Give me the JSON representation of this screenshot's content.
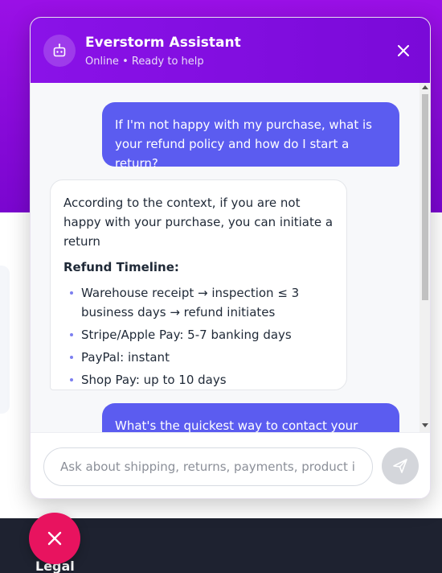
{
  "header": {
    "title": "Everstorm Assistant",
    "status": "Online • Ready to help",
    "avatar_icon": "robot-icon",
    "close_icon": "close-icon"
  },
  "messages": {
    "user_1": "If I'm not happy with my purchase, what is your refund policy and how do I start a return?",
    "bot_1": {
      "intro": "According to the context, if you are not happy with your purchase, you can initiate a return",
      "heading": "Refund Timeline:",
      "items": [
        "Warehouse receipt → inspection ≤ 3 business days → refund initiates",
        "Stripe/Apple Pay: 5-7 banking days",
        "PayPal: instant",
        "Shop Pay: up to 10 days"
      ]
    },
    "user_2": "What's the quickest way to contact your"
  },
  "input": {
    "placeholder": "Ask about shipping, returns, payments, product info...",
    "send_icon": "send-icon"
  },
  "fab": {
    "icon": "close-icon"
  },
  "footer": {
    "legal_label": "Legal"
  },
  "colors": {
    "header_gradient_start": "#8a12e8",
    "user_bubble": "#5b5cf0",
    "fab": "#e8135f",
    "footer_bg": "#1e2230"
  }
}
